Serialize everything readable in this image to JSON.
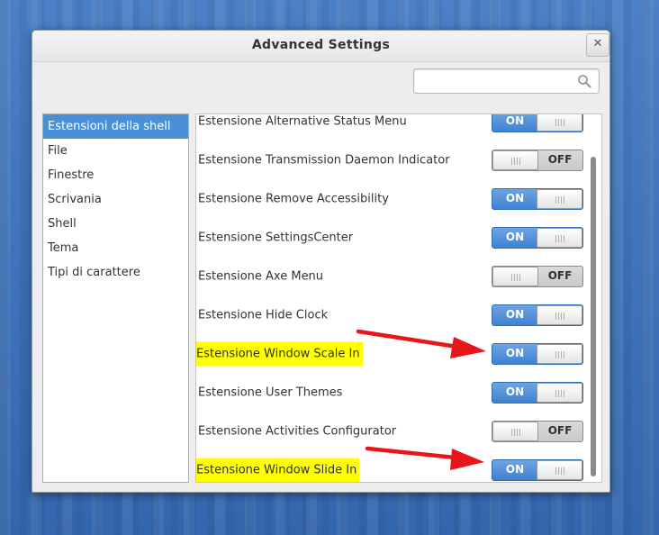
{
  "window": {
    "title": "Advanced Settings",
    "close_symbol": "✕"
  },
  "search": {
    "placeholder": "",
    "value": ""
  },
  "sidebar": {
    "items": [
      {
        "label": "Estensioni della shell",
        "selected": true
      },
      {
        "label": "File"
      },
      {
        "label": "Finestre"
      },
      {
        "label": "Scrivania"
      },
      {
        "label": "Shell"
      },
      {
        "label": "Tema"
      },
      {
        "label": "Tipi di carattere"
      }
    ]
  },
  "extensions": [
    {
      "label": "Estensione Alternative Status Menu",
      "state": "ON",
      "highlighted": false
    },
    {
      "label": "Estensione Transmission Daemon Indicator",
      "state": "OFF",
      "highlighted": false
    },
    {
      "label": "Estensione Remove Accessibility",
      "state": "ON",
      "highlighted": false
    },
    {
      "label": "Estensione SettingsCenter",
      "state": "ON",
      "highlighted": false
    },
    {
      "label": "Estensione Axe Menu",
      "state": "OFF",
      "highlighted": false
    },
    {
      "label": "Estensione Hide Clock",
      "state": "ON",
      "highlighted": false
    },
    {
      "label": "Estensione Window Scale In",
      "state": "ON",
      "highlighted": true
    },
    {
      "label": "Estensione User Themes",
      "state": "ON",
      "highlighted": false
    },
    {
      "label": "Estensione Activities Configurator",
      "state": "OFF",
      "highlighted": false
    },
    {
      "label": "Estensione Window Slide In",
      "state": "ON",
      "highlighted": true
    }
  ],
  "colors": {
    "accent": "#4a90d9",
    "highlight": "#ffff00",
    "arrow": "#e8161c",
    "switch_on": "#3f82d2"
  },
  "icons": {
    "search": "search-icon",
    "close": "close-icon"
  }
}
